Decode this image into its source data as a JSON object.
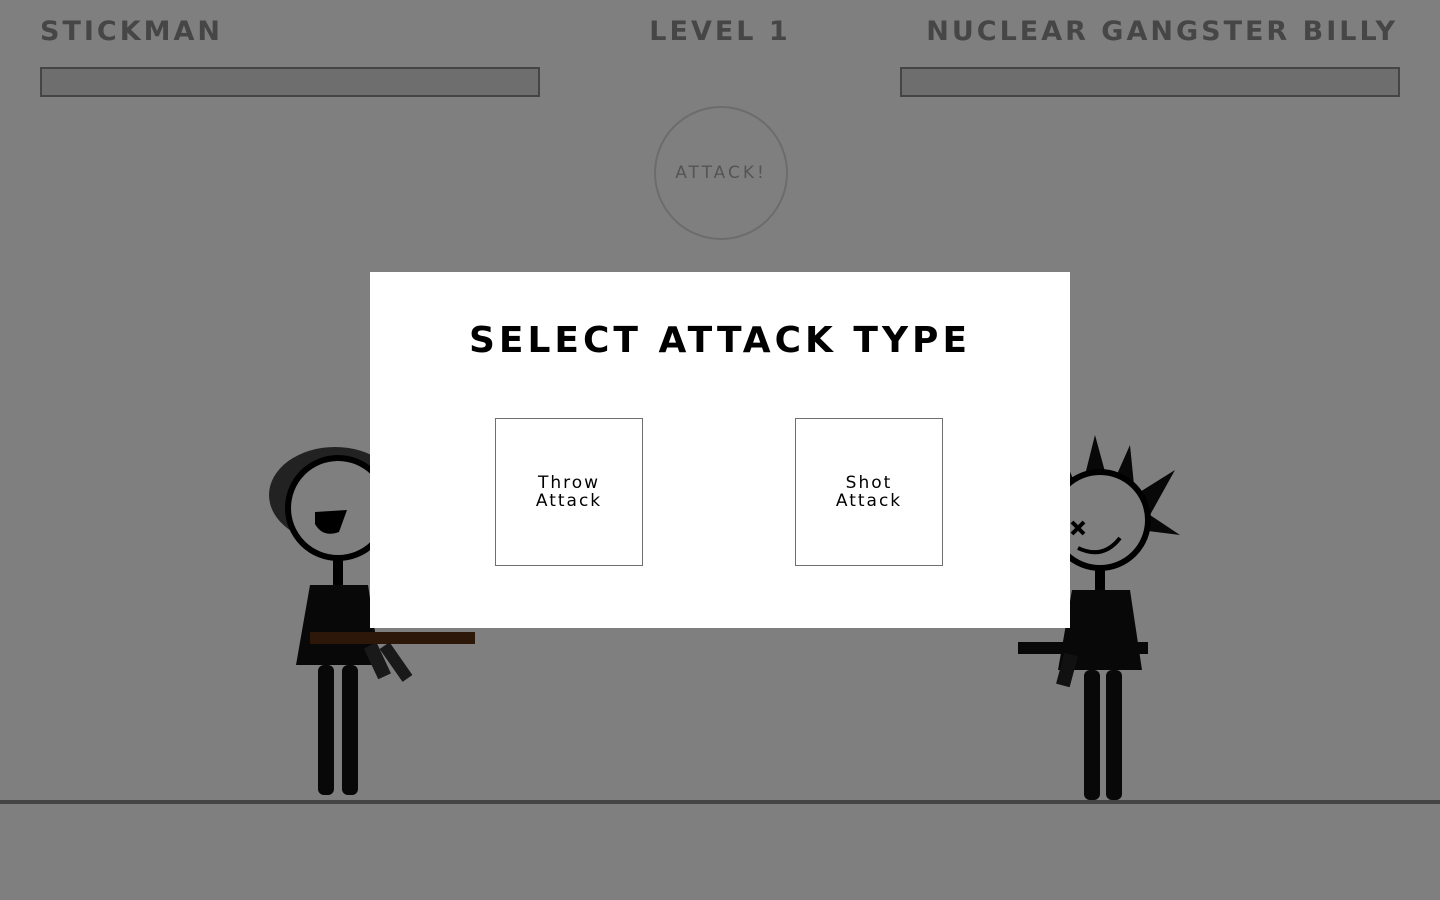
{
  "hud": {
    "player_name": "STICKMAN",
    "level": "LEVEL 1",
    "enemy_name": "NUCLEAR GANGSTER BILLY",
    "player_health_fraction": 1.0,
    "enemy_health_fraction": 1.0,
    "attack_button_label": "ATTACK!"
  },
  "modal": {
    "title": "SELECT ATTACK TYPE",
    "options": [
      {
        "label": "Throw Attack"
      },
      {
        "label": "Shot Attack"
      }
    ]
  },
  "colors": {
    "overlay": "#808080",
    "hud_text": "#8c8c8c",
    "modal_bg": "#ffffff"
  },
  "icons": {
    "player": "stickman-fighter-with-rifle-icon",
    "enemy": "spiky-hair-stickman-with-rifle-icon"
  }
}
